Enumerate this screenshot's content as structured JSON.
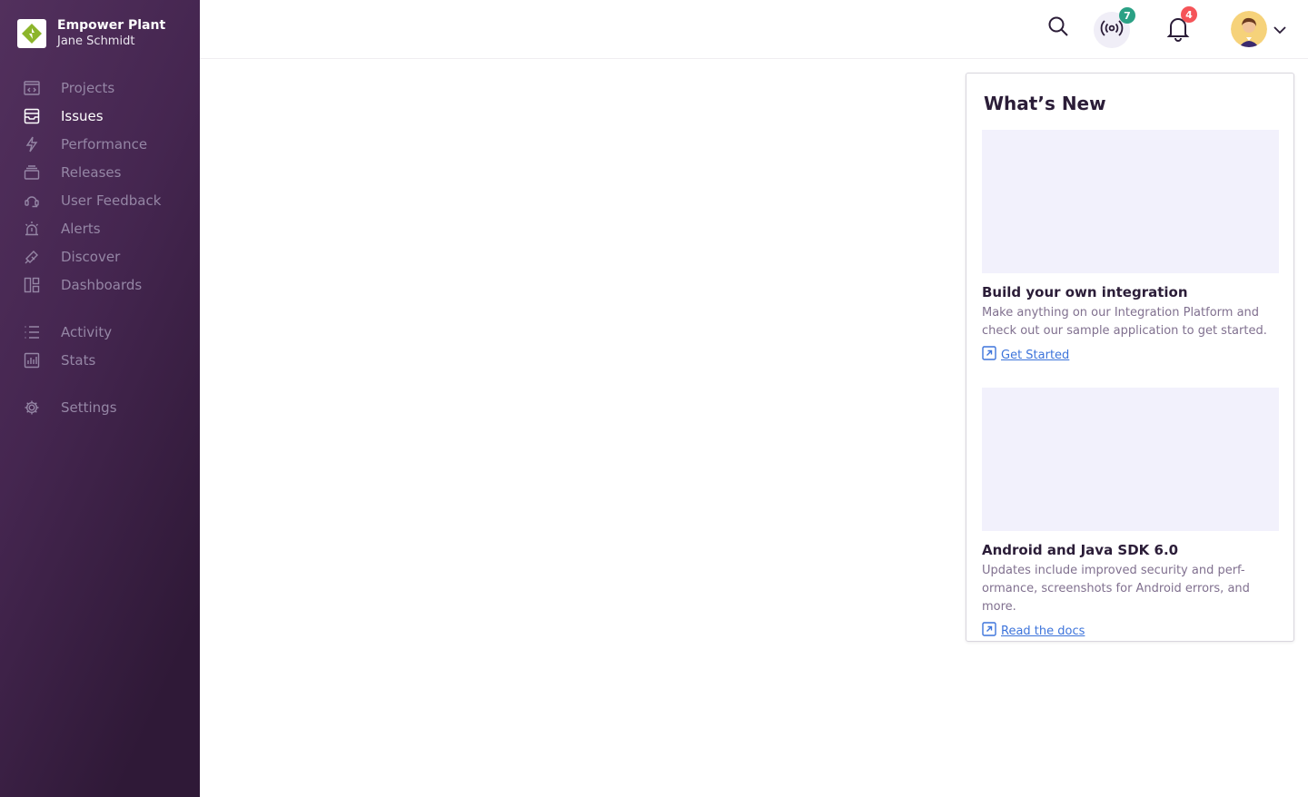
{
  "org": {
    "name": "Empower Plant",
    "user": "Jane Schmidt"
  },
  "sidebar": {
    "items": [
      {
        "label": "Projects",
        "icon": "projects-icon",
        "active": false
      },
      {
        "label": "Issues",
        "icon": "issues-icon",
        "active": true
      },
      {
        "label": "Performance",
        "icon": "performance-icon",
        "active": false
      },
      {
        "label": "Releases",
        "icon": "releases-icon",
        "active": false
      },
      {
        "label": "User Feedback",
        "icon": "user-feedback-icon",
        "active": false
      },
      {
        "label": "Alerts",
        "icon": "alerts-icon",
        "active": false
      },
      {
        "label": "Discover",
        "icon": "discover-icon",
        "active": false
      },
      {
        "label": "Dashboards",
        "icon": "dashboards-icon",
        "active": false
      },
      {
        "label": "Activity",
        "icon": "activity-icon",
        "active": false
      },
      {
        "label": "Stats",
        "icon": "stats-icon",
        "active": false
      },
      {
        "label": "Settings",
        "icon": "settings-icon",
        "active": false
      }
    ]
  },
  "header": {
    "broadcast_count": "7",
    "notification_count": "4",
    "colors": {
      "broadcast_badge": "#2ba185",
      "notification_badge": "#f55459"
    }
  },
  "whats_new": {
    "title": "What’s New",
    "cards": [
      {
        "title": "Build your own integration",
        "description": "Make anything on our Integration Platform and check out our sample application to get started.",
        "link": "Get Started"
      },
      {
        "title": "Android and Java SDK 6.0",
        "description": "Updates include improved security and perf- ormance, screenshots for Android errors, and more.",
        "link": "Read the docs"
      }
    ]
  },
  "colors": {
    "accent": "#3d74db",
    "sidebar_bg": "#452650"
  }
}
